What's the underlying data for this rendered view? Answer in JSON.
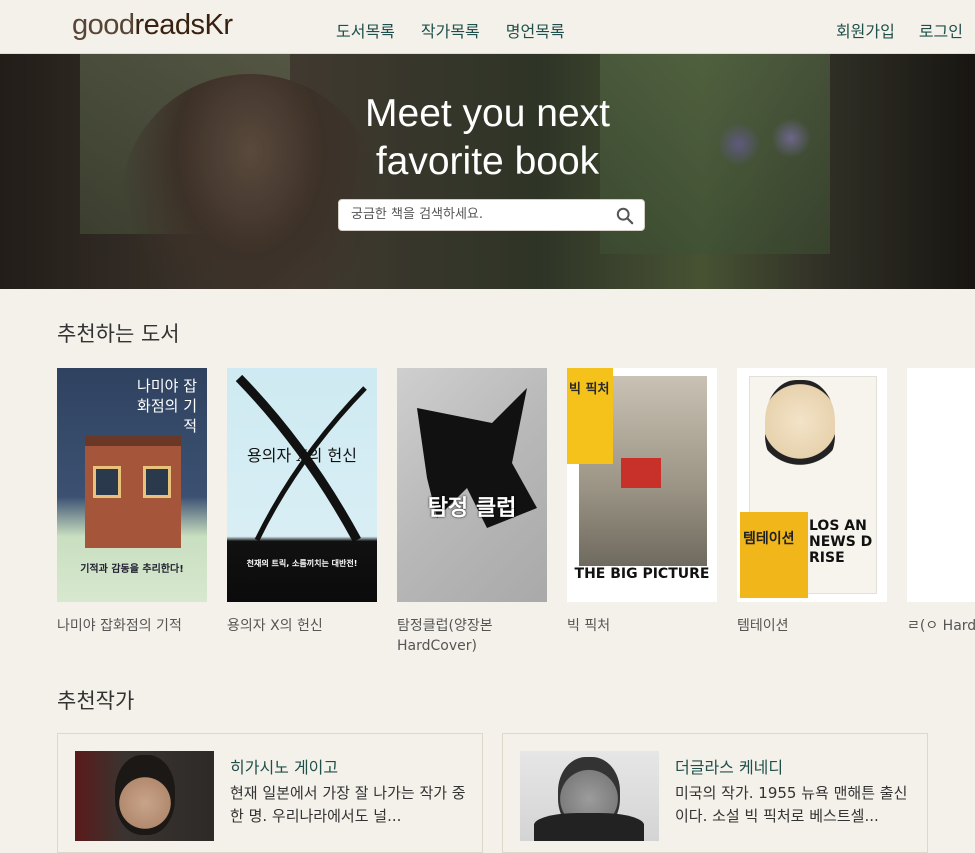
{
  "header": {
    "logo_light": "good",
    "logo_bold": "readsKr",
    "nav": [
      "도서목록",
      "작가목록",
      "명언목록"
    ],
    "signup": "회원가입",
    "login": "로그인"
  },
  "hero": {
    "title_line1": "Meet you next",
    "title_line2": "favorite book",
    "search_placeholder": "궁금한 책을 검색하세요."
  },
  "recommended_books": {
    "heading": "추천하는 도서",
    "items": [
      {
        "title": "나미야 잡화점의 기적",
        "cover_text": "나미야 잡화점의 기적",
        "cover_tagline": "기적과 감동을 추리한다!"
      },
      {
        "title": "용의자 X의 헌신",
        "cover_text": "용의자 X의 헌신",
        "cover_tagline": "천재의 트릭, 소름끼치는 대반전!"
      },
      {
        "title": "탐정클럽(양장본 HardCover)",
        "cover_text": "탐정 클럽"
      },
      {
        "title": "빅 픽처",
        "cover_text": "빅 픽처",
        "cover_tagline": "THE BIG PICTURE"
      },
      {
        "title": "템테이션",
        "cover_text": "템테이션",
        "cover_tagline": "LOS AN NEWS D RISE"
      },
      {
        "title": "ㄹ(ㅇ HardCover)",
        "cover_text": ""
      }
    ]
  },
  "recommended_authors": {
    "heading": "추천작가",
    "items": [
      {
        "name": "히가시노 게이고",
        "desc": "현재 일본에서 가장 잘 나가는 작가 중 한 명. 우리나라에서도 널..."
      },
      {
        "name": "더글라스 케네디",
        "desc": "미국의 작가. 1955 뉴욕 맨해튼 출신이다. 소설 빅 픽처로 베스트셀..."
      }
    ]
  },
  "colors": {
    "background": "#f4f1ea",
    "nav_link": "#1f4f4a",
    "logo": "#382110"
  }
}
